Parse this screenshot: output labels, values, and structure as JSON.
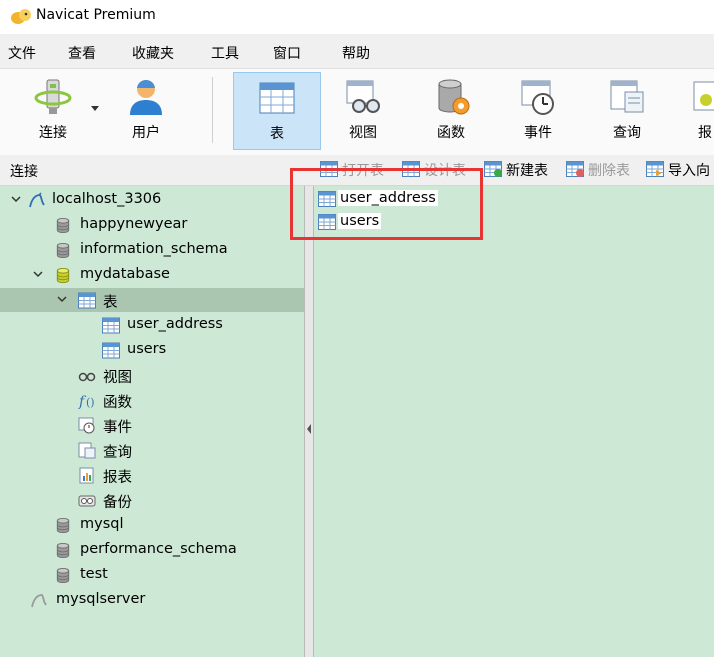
{
  "window": {
    "title": "Navicat Premium"
  },
  "menu": [
    "文件",
    "查看",
    "收藏夹",
    "工具",
    "窗口",
    "帮助"
  ],
  "toolbar": {
    "connect": "连接",
    "user": "用户",
    "table": "表",
    "view": "视图",
    "function": "函数",
    "event": "事件",
    "query": "查询",
    "report": "报"
  },
  "object_bar": {
    "connection_label": "连接",
    "open_table": "打开表",
    "design_table": "设计表",
    "new_table": "新建表",
    "delete_table": "删除表",
    "import_wizard": "导入向"
  },
  "tree": {
    "connection": "localhost_3306",
    "databases": {
      "happynewyear": "happynewyear",
      "information_schema": "information_schema",
      "mydatabase": "mydatabase",
      "mysql": "mysql",
      "performance_schema": "performance_schema",
      "test": "test"
    },
    "groups": {
      "tables": "表",
      "views": "视图",
      "functions": "函数",
      "events": "事件",
      "queries": "查询",
      "reports": "报表",
      "backups": "备份"
    },
    "tables": [
      "user_address",
      "users"
    ],
    "other_connection": "mysqlserver"
  },
  "content": {
    "items": [
      "user_address",
      "users"
    ]
  },
  "colors": {
    "pane_bg": "#cde8d4",
    "selected_row": "#aac6b1",
    "toolbar_active": "#cce4f7",
    "highlight_box": "#e93434"
  }
}
